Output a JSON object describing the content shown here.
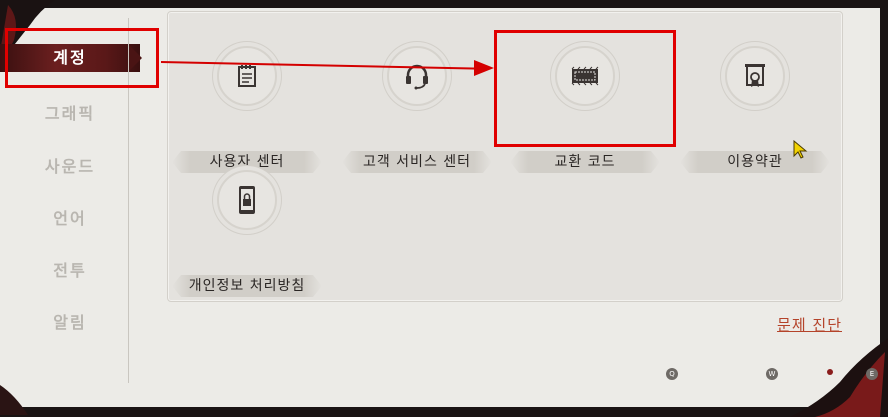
{
  "sidebar": {
    "items": [
      {
        "label": "계정",
        "active": true
      },
      {
        "label": "그래픽",
        "active": false
      },
      {
        "label": "사운드",
        "active": false
      },
      {
        "label": "언어",
        "active": false
      },
      {
        "label": "전투",
        "active": false
      },
      {
        "label": "알림",
        "active": false
      }
    ]
  },
  "tiles": [
    {
      "label": "사용자 센터",
      "icon": "notebook-icon"
    },
    {
      "label": "고객 서비스 센터",
      "icon": "headset-icon"
    },
    {
      "label": "교환 코드",
      "icon": "ticket-icon"
    },
    {
      "label": "이용약관",
      "icon": "certificate-icon"
    },
    {
      "label": "개인정보 처리방침",
      "icon": "phone-lock-icon"
    }
  ],
  "diagnose_label": "문제 진단",
  "hotkeys": [
    "Q",
    "W",
    "E"
  ],
  "colors": {
    "accent_red": "#e00000",
    "sidebar_active": "#5a1818",
    "link": "#b4432a",
    "panel_bg": "#e4e2de"
  }
}
